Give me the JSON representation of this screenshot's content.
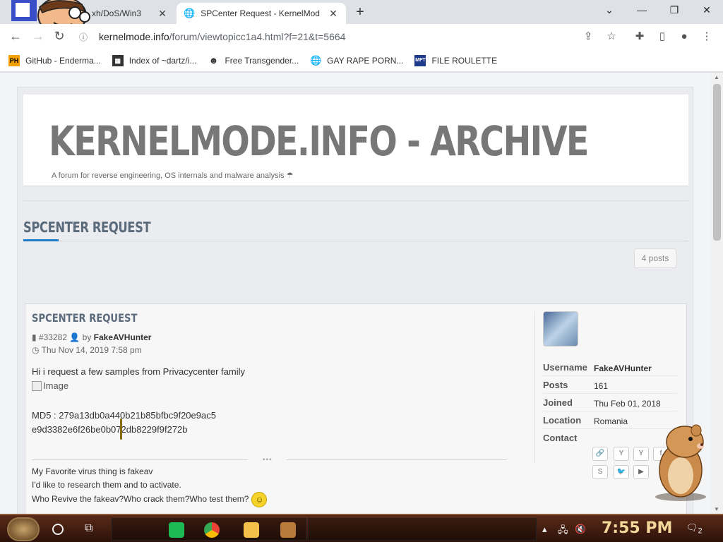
{
  "browser": {
    "tabs": [
      {
        "title": "xh/DoS/Win3",
        "active": false
      },
      {
        "title": "SPCenter Request - KernelMod",
        "active": true
      }
    ],
    "new_tab_label": "+",
    "url_domain": "kernelmode.info",
    "url_path": "/forum/viewtopicc1a4.html?f=21&t=5664",
    "bookmarks": [
      {
        "icon_text": "PH",
        "label": "GitHub - Enderma..."
      },
      {
        "icon_text": "",
        "label": "Index of ~dartz/i..."
      },
      {
        "icon_text": "",
        "label": "Free Transgender..."
      },
      {
        "icon_text": "",
        "label": "GAY RAPE PORN..."
      },
      {
        "icon_text": "MFT",
        "label": "FILE ROULETTE"
      }
    ]
  },
  "site": {
    "title": "KERNELMODE.INFO - ARCHIVE",
    "description": "A forum for reverse engineering, OS internals and malware analysis"
  },
  "topic": {
    "title": "SPCENTER REQUEST",
    "posts_count": "4 posts"
  },
  "post": {
    "title": "SPCENTER REQUEST",
    "id": "#33282",
    "by_label": "by",
    "author": "FakeAVHunter",
    "date": "Thu Nov 14, 2019 7:58 pm",
    "body_line1": "Hi i request a few samples from Privacycenter family",
    "image_alt": "Image",
    "md5_line": "MD5 : 279a13db0a440b21b85bfbc9f20e9ac5",
    "hash_line2": "e9d3382e6f26be0b072db8229f9f272b",
    "sig_lines": [
      "My Favorite virus thing is fakeav",
      "I'd like to research them and to activate.",
      "Who Revive the fakeav?Who crack them?Who test them?"
    ]
  },
  "profile": {
    "username_label": "Username",
    "username": "FakeAVHunter",
    "posts_label": "Posts",
    "posts": "161",
    "joined_label": "Joined",
    "joined": "Thu Feb 01, 2018",
    "location_label": "Location",
    "location": "Romania",
    "contact_label": "Contact",
    "contact_icons": [
      "link-icon",
      "yahoo-icon",
      "yahoo-icon",
      "facebook-icon",
      "skype-icon",
      "twitter-icon",
      "youtube-icon"
    ]
  },
  "taskbar": {
    "time": "7:55 PM",
    "notification_count": "2"
  },
  "colors": {
    "accent": "#1f7dc7",
    "title_gray": "#777777"
  }
}
